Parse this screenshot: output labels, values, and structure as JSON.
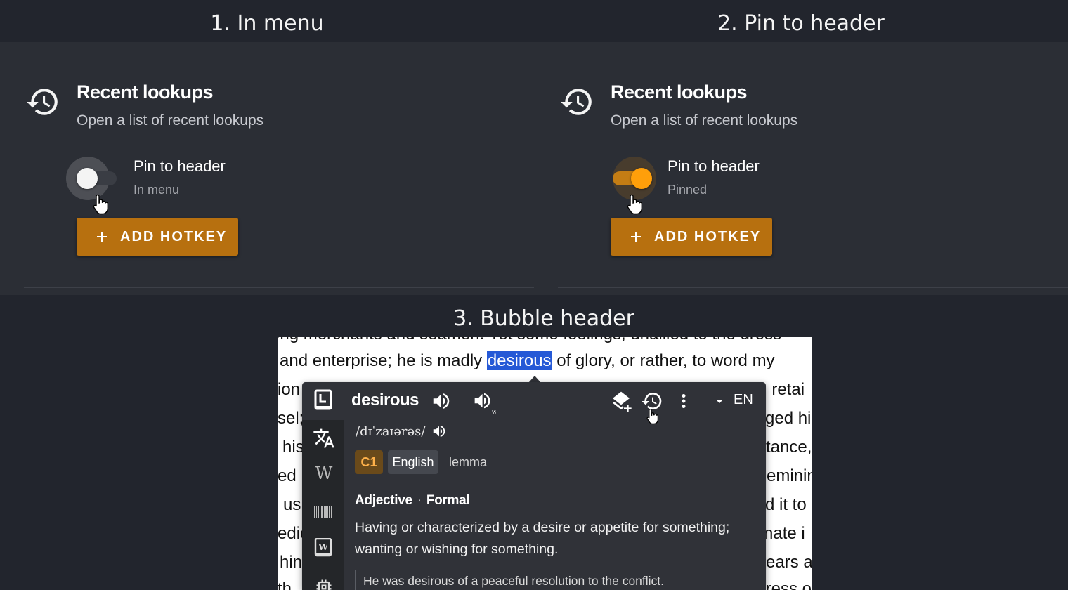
{
  "steps": {
    "step1": "1. In menu",
    "step2": "2. Pin to header",
    "step3": "3. Bubble header"
  },
  "settings": {
    "title": "Recent lookups",
    "subtitle": "Open a list of recent lookups",
    "pin_label": "Pin to header",
    "state_off": "In menu",
    "state_on": "Pinned",
    "add_hotkey": "ADD HOTKEY"
  },
  "book": {
    "lines": [
      "ong merchants and seamen. Yet some feelings, unallied to the dross",
      "and enterprise; he is madly",
      "of glory, or rather, to word my",
      "ion",
      ", retai",
      "sel;",
      "ged hi",
      "his",
      "tance,",
      "ed",
      "eminin",
      "us",
      "d it to",
      "edic",
      "nate i",
      "hin",
      "years a",
      "th",
      "tress o"
    ],
    "highlight": "desirous"
  },
  "bubble": {
    "word": "desirous",
    "language_code": "EN",
    "ipa": "/dɪˈzaɪərəs/",
    "level": "C1",
    "language": "English",
    "lemma": "lemma",
    "pos": "Adjective",
    "register": "Formal",
    "definition": "Having or characterized by a desire or appetite for something; wanting or wishing for something.",
    "example_before": "He was ",
    "example_word": "desirous",
    "example_after": " of a peaceful resolution to the conflict."
  },
  "colors": {
    "accent": "#ff9f0a",
    "button": "#b7700f",
    "panel": "#2b2e35",
    "highlight": "#2559d6"
  }
}
